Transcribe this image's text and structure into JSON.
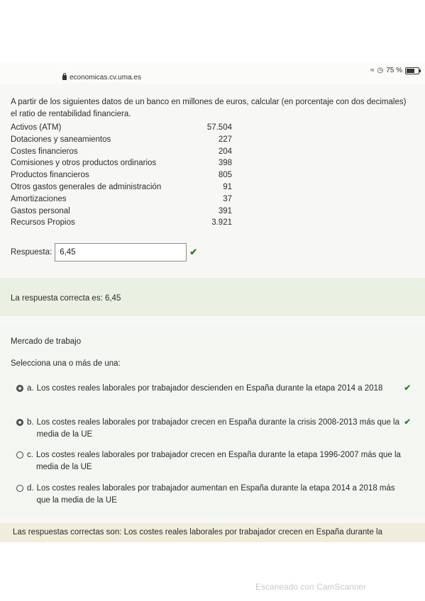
{
  "browser": {
    "url": "economicas.cv.uma.es",
    "battery": "75 %",
    "battery_level": 0.75
  },
  "question1": {
    "text": "A partir de los siguientes datos de un banco en millones de euros, calcular (en porcentaje con dos decimales) el ratio de rentabilidad financiera.",
    "rows": [
      {
        "label": "Activos (ATM)",
        "value": "57.504"
      },
      {
        "label": "Dotaciones y saneamientos",
        "value": "227"
      },
      {
        "label": "Costes financieros",
        "value": "204"
      },
      {
        "label": "Comisiones y otros productos ordinarios",
        "value": "398"
      },
      {
        "label": "Productos financieros",
        "value": "805"
      },
      {
        "label": "Otros gastos generales de administración",
        "value": "91"
      },
      {
        "label": "Amortizaciones",
        "value": "37"
      },
      {
        "label": "Gastos personal",
        "value": "391"
      },
      {
        "label": "Recursos Propios",
        "value": "3.921"
      }
    ],
    "answer_label": "Respuesta:",
    "answer_value": "6,45",
    "feedback": "La respuesta correcta es: 6,45"
  },
  "question2": {
    "title": "Mercado de trabajo",
    "prompt": "Selecciona una o más de una:",
    "options": [
      {
        "letter": "a.",
        "text": "Los costes reales laborales por trabajador descienden en España durante la etapa 2014 a 2018",
        "checked": true
      },
      {
        "letter": "b.",
        "text": "Los costes reales laborales por trabajador crecen en España durante la crisis 2008-2013 más que la media de la UE",
        "checked": true
      },
      {
        "letter": "c.",
        "text": "Los costes reales laborales por trabajador crecen en España durante la etapa 1996-2007 más que la media de la UE",
        "checked": false
      },
      {
        "letter": "d.",
        "text": "Los costes reales laborales por trabajador aumentan en España durante la etapa 2014 a 2018 más que la media de la UE",
        "checked": false
      }
    ],
    "correct_answers": "Las respuestas correctas son: Los costes reales laborales por trabajador crecen en España durante la"
  },
  "watermark": "Escaneado con CamScanner",
  "colors": {
    "check_green": "#2e7d32"
  }
}
